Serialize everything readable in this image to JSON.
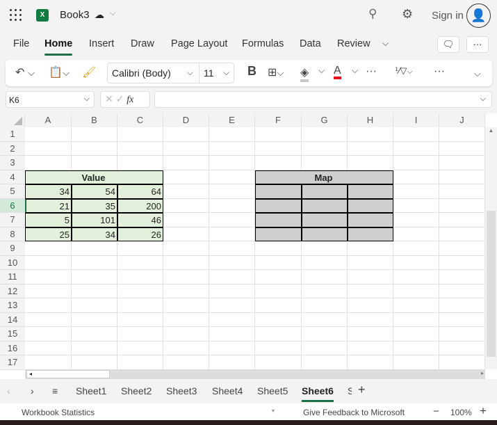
{
  "app": {
    "doc_title": "Book3",
    "sign_in": "Sign in",
    "logo": "X"
  },
  "menu": {
    "tabs": [
      "File",
      "Home",
      "Insert",
      "Draw",
      "Page Layout",
      "Formulas",
      "Data",
      "Review"
    ],
    "active": "Home"
  },
  "ribbon": {
    "font_name": "Calibri (Body)",
    "font_size": "11",
    "bold": "B",
    "font_color": "#e81123",
    "fill_color": "#c8c8c8"
  },
  "formula_bar": {
    "name_box": "K6",
    "fx": "fx",
    "value": ""
  },
  "grid": {
    "columns": [
      "A",
      "B",
      "C",
      "D",
      "E",
      "F",
      "G",
      "H",
      "I",
      "J"
    ],
    "rows": [
      "1",
      "2",
      "3",
      "4",
      "5",
      "6",
      "7",
      "8",
      "9",
      "10",
      "11",
      "12",
      "13",
      "14",
      "15",
      "16",
      "17"
    ],
    "value_header": "Value",
    "map_header": "Map",
    "values": [
      [
        34,
        54,
        64
      ],
      [
        21,
        35,
        200
      ],
      [
        5,
        101,
        46
      ],
      [
        25,
        34,
        26
      ]
    ],
    "value_fill": "#e2efda",
    "map_fill": "#d0cece",
    "selected_row": "6"
  },
  "sheet_tabs": {
    "tabs": [
      "Sheet1",
      "Sheet2",
      "Sheet3",
      "Sheet4",
      "Sheet5",
      "Sheet6",
      "S"
    ],
    "active": "Sheet6",
    "add": "+"
  },
  "status_bar": {
    "left": "Workbook Statistics",
    "feedback": "Give Feedback to Microsoft",
    "zoom": "100%",
    "zoom_out": "−",
    "zoom_in": "+"
  }
}
